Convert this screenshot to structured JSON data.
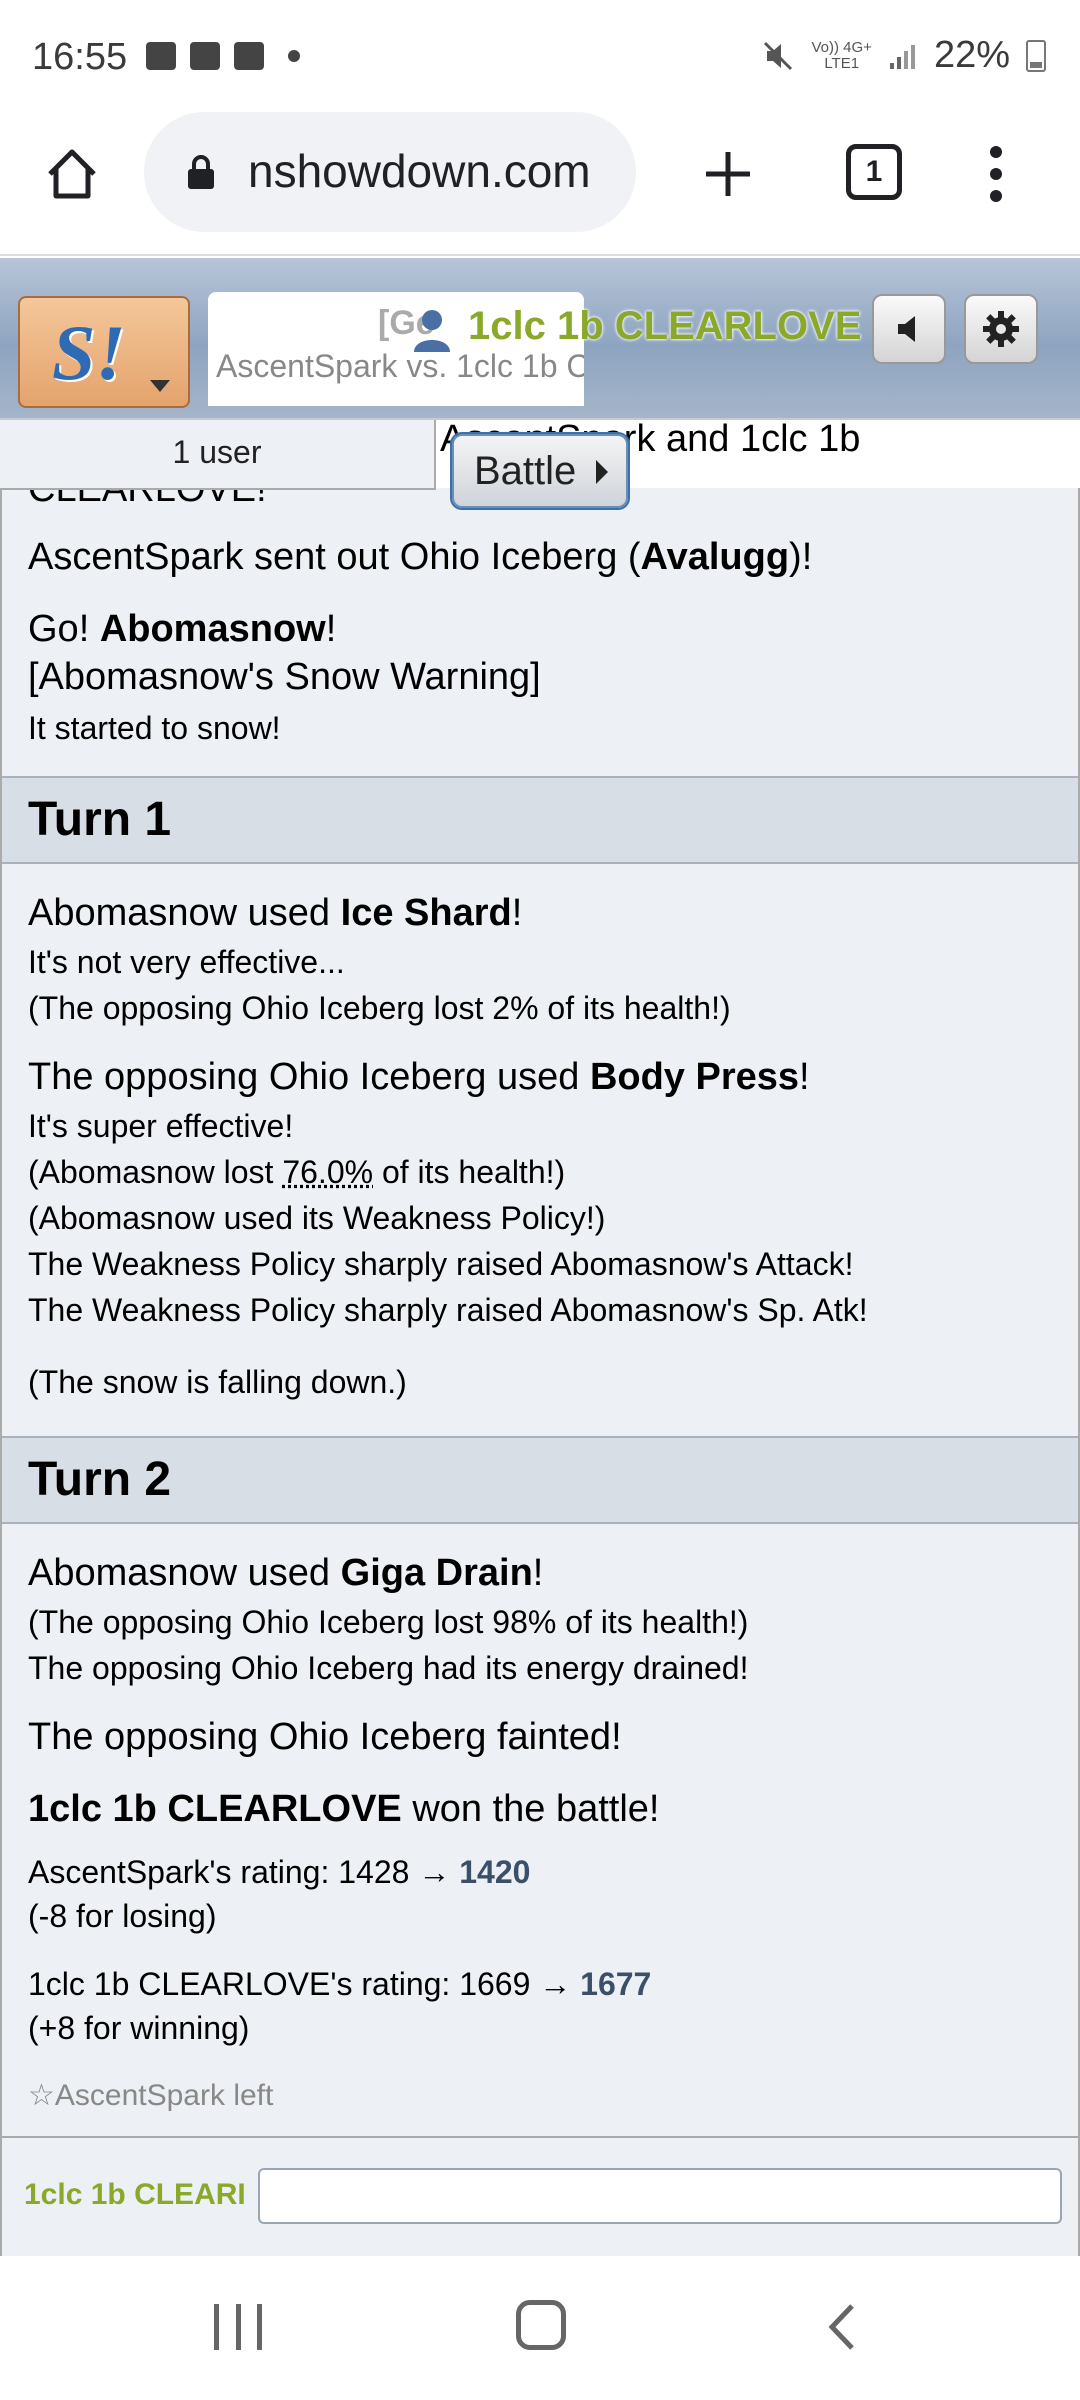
{
  "status_bar": {
    "time": "16:55",
    "network_top": "Vo)) 4G+",
    "network_bottom": "LTE1",
    "battery": "22%"
  },
  "browser": {
    "url": "nshowdown.com",
    "tab_count": "1"
  },
  "header": {
    "room_tab_format": "[Ge",
    "room_tab_title": "AscentSpark vs. 1clc 1b C",
    "opponent_name": "1clc 1b CLEARLOVE",
    "opponent_color": "#8aa82a"
  },
  "room_bar": {
    "user_count": "1 user",
    "peek_text": "AscentSpark and 1clc 1b",
    "battle_button": "Battle"
  },
  "log": {
    "clipped_line": "CLEARLOVE!",
    "intro": [
      {
        "pre": "AscentSpark sent out Ohio Iceberg (",
        "bold": "Avalugg",
        "post": ")!"
      },
      {
        "pre": "Go! ",
        "bold": "Abomasnow",
        "post": "!"
      }
    ],
    "ability": "[Abomasnow's Snow Warning]",
    "snow_start": "It started to snow!",
    "turn1": {
      "title": "Turn 1",
      "move1_pre": "Abomasnow used ",
      "move1": "Ice Shard",
      "move1_post": "!",
      "move1_eff": "It's not very effective...",
      "move1_dmg": "(The opposing Ohio Iceberg lost 2% of its health!)",
      "move2_pre": "The opposing Ohio Iceberg used ",
      "move2": "Body Press",
      "move2_post": "!",
      "move2_eff": "It's super effective!",
      "move2_dmg_pre": "(Abomasnow lost ",
      "move2_dmg_pct": "76.0%",
      "move2_dmg_post": " of its health!)",
      "item": "(Abomasnow used its Weakness Policy!)",
      "boost1": "The Weakness Policy sharply raised Abomasnow's Attack!",
      "boost2": "The Weakness Policy sharply raised Abomasnow's Sp. Atk!",
      "weather": "(The snow is falling down.)"
    },
    "turn2": {
      "title": "Turn 2",
      "move_pre": "Abomasnow used ",
      "move": "Giga Drain",
      "move_post": "!",
      "dmg": "(The opposing Ohio Iceberg lost 98% of its health!)",
      "drain": "The opposing Ohio Iceberg had its energy drained!",
      "faint": "The opposing Ohio Iceberg fainted!",
      "winner": "1clc 1b CLEARLOVE",
      "won_text": " won the battle!",
      "rating1_pre": "AscentSpark's rating: 1428 → ",
      "rating1_new": "1420",
      "rating1_delta": "(-8 for losing)",
      "rating2_pre": "1clc 1b CLEARLOVE's rating: 1669 → ",
      "rating2_new": "1677",
      "rating2_delta": "(+8 for winning)",
      "left": "☆AscentSpark left"
    }
  },
  "chat": {
    "name": "1clc 1b CLEARI",
    "input_value": ""
  }
}
